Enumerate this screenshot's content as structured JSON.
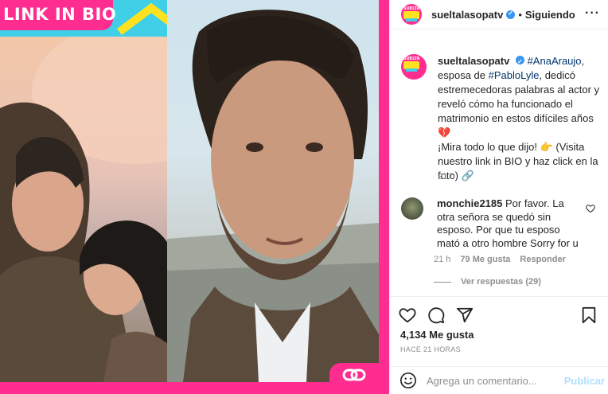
{
  "post_image": {
    "banner_text": "LINK IN BIO",
    "link_icon": "link-chain-icon",
    "brand_colors": {
      "pink": "#ff2d8f",
      "cyan": "#3fd0e8",
      "yellow": "#ffe21f"
    }
  },
  "header": {
    "username": "sueltalasopatv",
    "verified_icon": "verified-badge-icon",
    "separator": "•",
    "follow_label": "Siguiendo",
    "more_icon": "more-options-icon"
  },
  "caption": {
    "username": "sueltalasopatv",
    "hashtag1": "#AnaAraujo",
    "text1": ", esposa de ",
    "hashtag2": "#PabloLyle",
    "text2": ", dedicó estremecedoras palabras al actor y reveló cómo ha funcionado el matrimonio en estos difíciles años 💔",
    "text3": "¡Mira todo lo que dijo! 👉 (Visita nuestro link in BIO y haz click en la foto) 🔗",
    "time": "21 h"
  },
  "comment": {
    "username": "monchie2185",
    "text": "Por favor. La otra señora se quedó sin esposo. Por que tu esposo mató a otro hombre Sorry for u",
    "time": "21 h",
    "likes": "79 Me gusta",
    "reply_label": "Responder",
    "view_replies": "Ver respuestas (29)"
  },
  "actions": {
    "like_icon": "heart-icon",
    "comment_icon": "comment-bubble-icon",
    "share_icon": "paper-plane-icon",
    "save_icon": "bookmark-icon",
    "likes": "4,134 Me gusta",
    "posted_ago": "HACE 21 HORAS"
  },
  "comment_box": {
    "placeholder": "Agrega un comentario...",
    "emoji_icon": "emoji-icon",
    "publish_label": "Publicar"
  }
}
